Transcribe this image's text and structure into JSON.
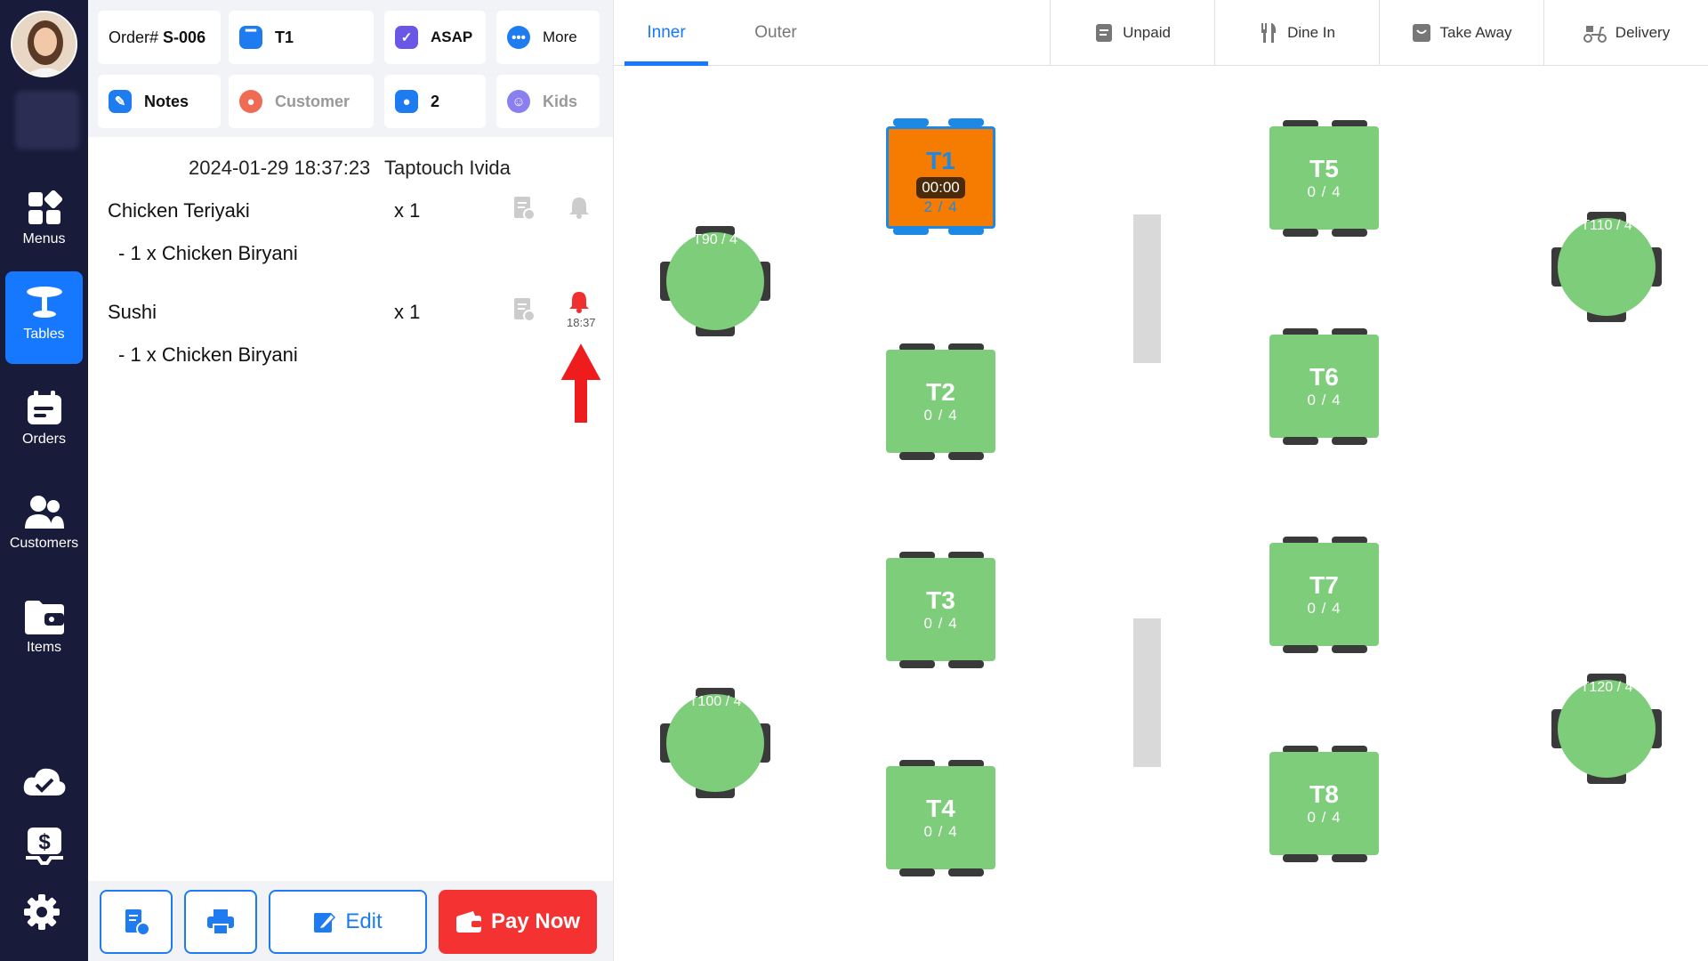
{
  "nav": {
    "items": [
      {
        "label": "Menus",
        "icon": "menus-icon"
      },
      {
        "label": "Tables",
        "icon": "tables-icon",
        "active": true
      },
      {
        "label": "Orders",
        "icon": "orders-icon"
      },
      {
        "label": "Customers",
        "icon": "customers-icon"
      },
      {
        "label": "Items",
        "icon": "items-icon"
      }
    ],
    "bottom_icons": [
      "cloud-sync-icon",
      "cash-icon",
      "settings-icon"
    ]
  },
  "order_header": {
    "order_prefix": "Order#",
    "order_number": "S-006",
    "table": "T1",
    "timing": "ASAP",
    "more": "More",
    "notes": "Notes",
    "customer": "Customer",
    "guests": "2",
    "kids": "Kids"
  },
  "order": {
    "datetime": "2024-01-29 18:37:23",
    "staff": "Taptouch Ivida",
    "items": [
      {
        "name": "Chicken Teriyaki",
        "qty": "x 1",
        "modifier": "- 1 x Chicken Biryani",
        "bell_active": false,
        "bell_time": ""
      },
      {
        "name": "Sushi",
        "qty": "x 1",
        "modifier": "- 1 x Chicken Biryani",
        "bell_active": true,
        "bell_time": "18:37"
      }
    ]
  },
  "footer": {
    "edit": "Edit",
    "pay": "Pay Now"
  },
  "floor": {
    "tabs": [
      "Inner",
      "Outer"
    ],
    "active_tab": "Inner",
    "filters": [
      "Unpaid",
      "Dine In",
      "Take Away",
      "Delivery"
    ],
    "tables": [
      {
        "name": "T1",
        "count": "2 / 4",
        "timer": "00:00",
        "status": "occupied"
      },
      {
        "name": "T2",
        "count": "0 / 4"
      },
      {
        "name": "T3",
        "count": "0 / 4"
      },
      {
        "name": "T4",
        "count": "0 / 4"
      },
      {
        "name": "T5",
        "count": "0 / 4"
      },
      {
        "name": "T6",
        "count": "0 / 4"
      },
      {
        "name": "T7",
        "count": "0 / 4"
      },
      {
        "name": "T8",
        "count": "0 / 4"
      },
      {
        "name": "T9",
        "count": "0 / 4"
      },
      {
        "name": "T10",
        "count": "0 / 4"
      },
      {
        "name": "T11",
        "count": "0 / 4"
      },
      {
        "name": "T12",
        "count": "0 / 4"
      }
    ]
  },
  "colors": {
    "nav_bg": "#181b3a",
    "accent": "#1677ff",
    "table_free": "#7dcd7a",
    "table_occupied": "#f57c00",
    "pay": "#f53232"
  }
}
